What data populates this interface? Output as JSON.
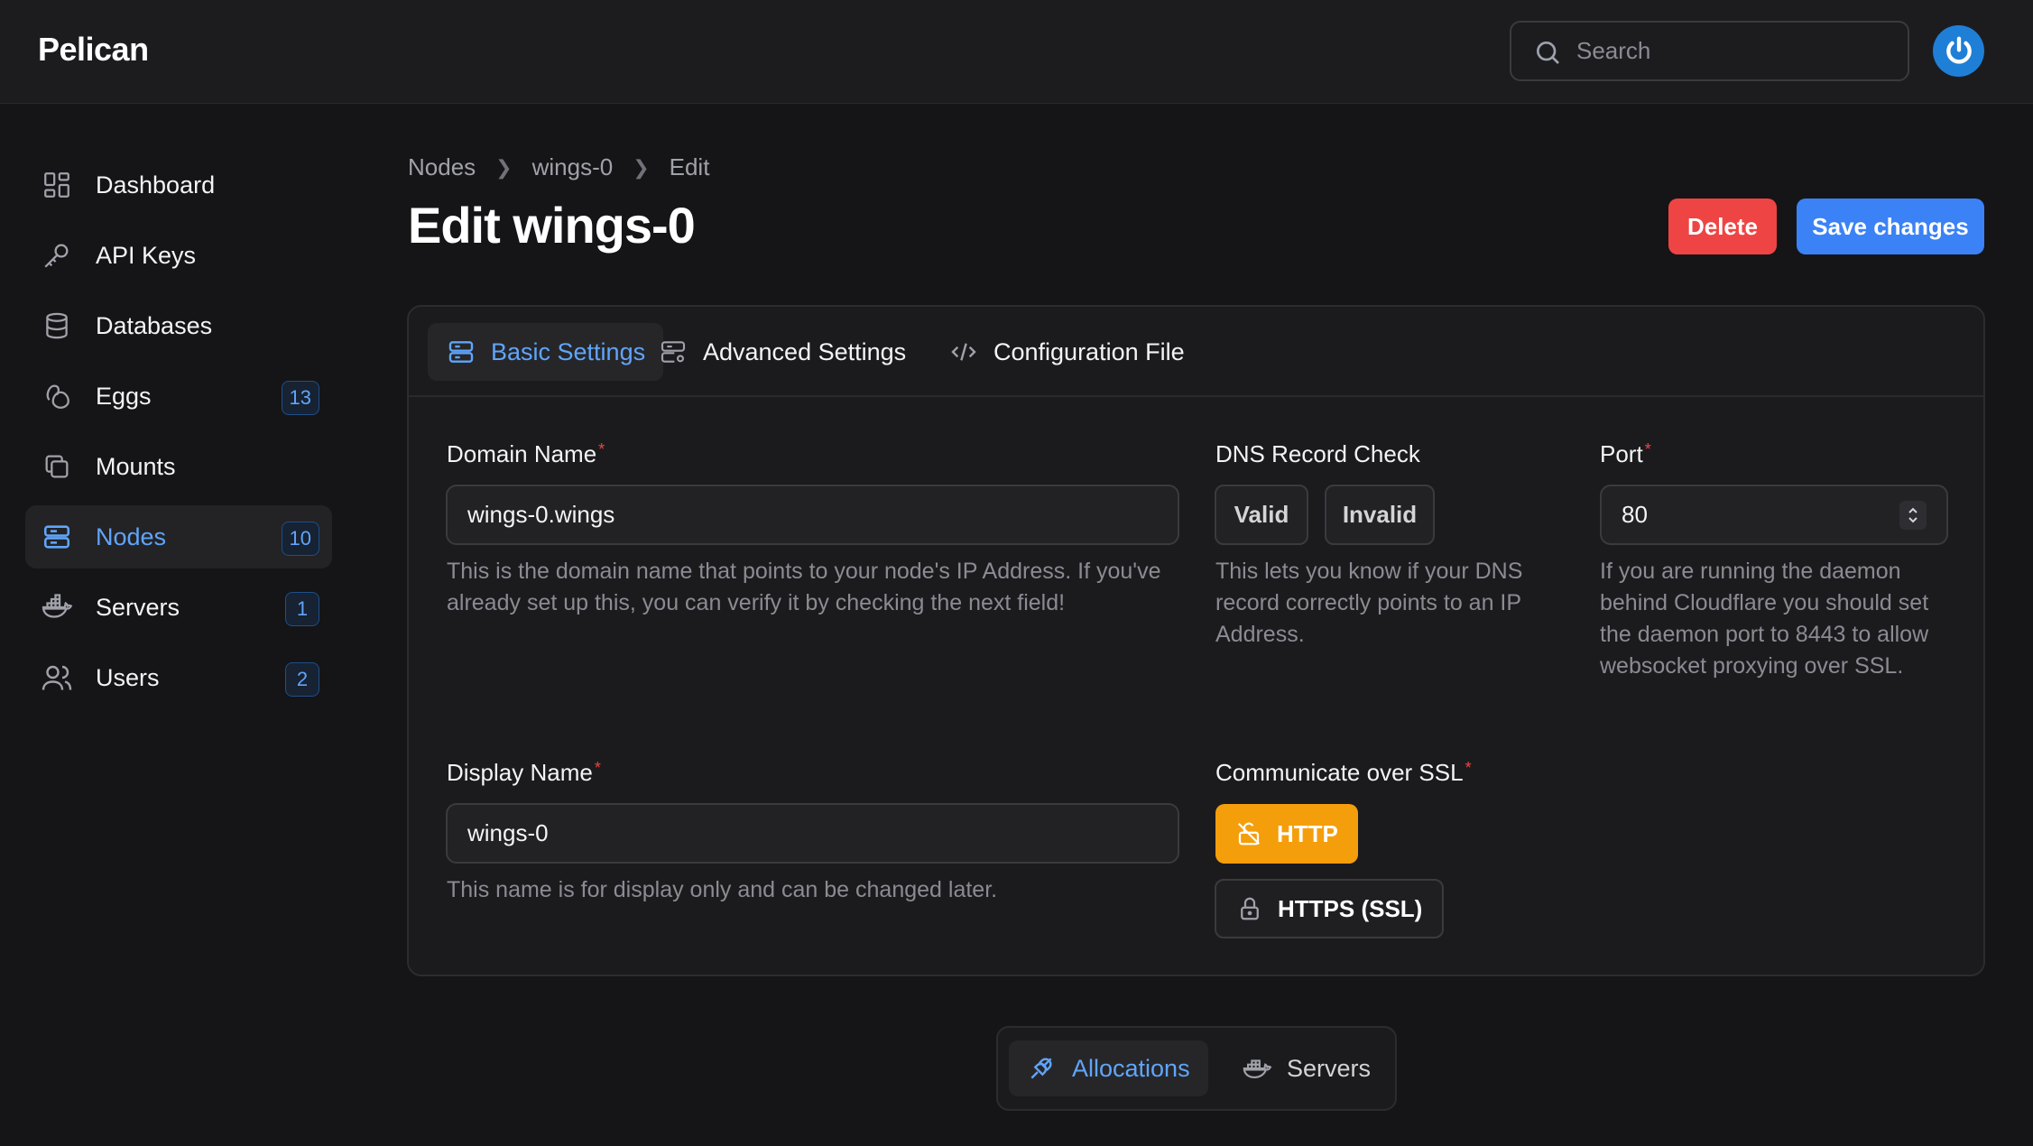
{
  "app": {
    "brand": "Pelican"
  },
  "search": {
    "placeholder": "Search"
  },
  "sidebar": {
    "items": [
      {
        "label": "Dashboard",
        "icon": "dashboard-icon",
        "badge": null,
        "active": false
      },
      {
        "label": "API Keys",
        "icon": "key-icon",
        "badge": null,
        "active": false
      },
      {
        "label": "Databases",
        "icon": "database-icon",
        "badge": null,
        "active": false
      },
      {
        "label": "Eggs",
        "icon": "egg-icon",
        "badge": "13",
        "active": false
      },
      {
        "label": "Mounts",
        "icon": "mount-icon",
        "badge": null,
        "active": false
      },
      {
        "label": "Nodes",
        "icon": "server-stack-icon",
        "badge": "10",
        "active": true
      },
      {
        "label": "Servers",
        "icon": "docker-icon",
        "badge": "1",
        "active": false
      },
      {
        "label": "Users",
        "icon": "users-icon",
        "badge": "2",
        "active": false
      }
    ]
  },
  "breadcrumb": [
    "Nodes",
    "wings-0",
    "Edit"
  ],
  "page": {
    "title": "Edit wings-0",
    "delete_label": "Delete",
    "save_label": "Save changes"
  },
  "tabs": [
    {
      "label": "Basic Settings",
      "active": true
    },
    {
      "label": "Advanced Settings",
      "active": false
    },
    {
      "label": "Configuration File",
      "active": false
    }
  ],
  "form": {
    "domain": {
      "label": "Domain Name",
      "required": "*",
      "value": "wings-0.wings",
      "help": "This is the domain name that points to your node's IP Address. If you've already set up this, you can verify it by checking the next field!"
    },
    "dns": {
      "label": "DNS Record Check",
      "valid_label": "Valid",
      "invalid_label": "Invalid",
      "help": "This lets you know if your DNS record correctly points to an IP Address."
    },
    "port": {
      "label": "Port",
      "required": "*",
      "value": "80",
      "help": "If you are running the daemon behind Cloudflare you should set the daemon port to 8443 to allow websocket proxying over SSL."
    },
    "display": {
      "label": "Display Name",
      "required": "*",
      "value": "wings-0",
      "help": "This name is for display only and can be changed later."
    },
    "ssl": {
      "label": "Communicate over SSL",
      "required": "*",
      "http_label": "HTTP",
      "https_label": "HTTPS (SSL)",
      "selected": "HTTP"
    }
  },
  "bottom_tabs": [
    {
      "label": "Allocations",
      "active": true
    },
    {
      "label": "Servers",
      "active": false
    }
  ],
  "colors": {
    "accent": "#60a5fa",
    "primary": "#3b82f6",
    "danger": "#ef4444",
    "warning": "#f59e0b",
    "background": "#151517"
  }
}
